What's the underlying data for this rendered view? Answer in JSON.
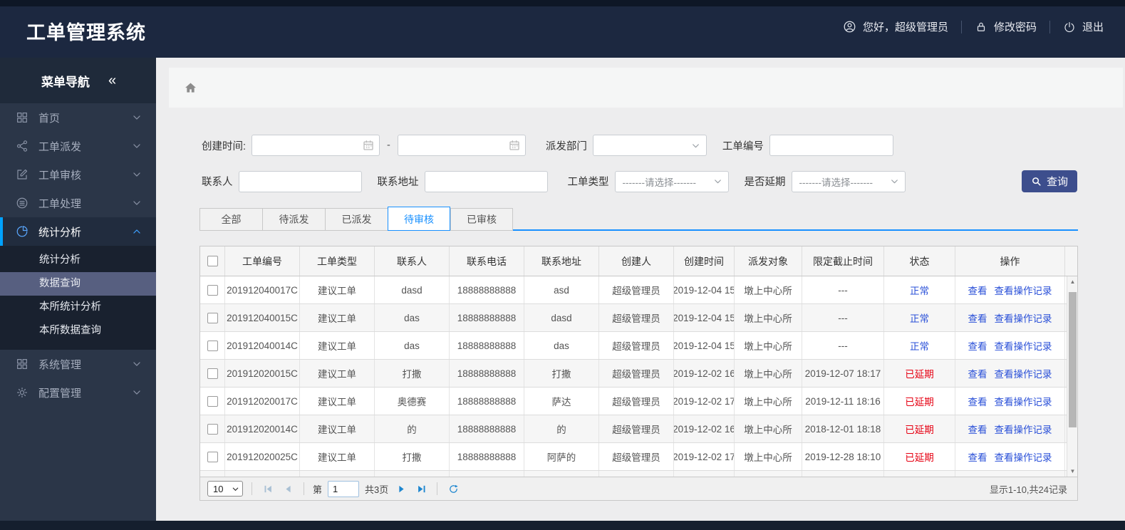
{
  "header": {
    "title": "工单管理系统",
    "greeting": "您好，超级管理员",
    "change_password": "修改密码",
    "logout": "退出"
  },
  "sidebar": {
    "title": "菜单导航",
    "collapse_icon": "«",
    "items": [
      {
        "key": "home",
        "label": "首页",
        "icon": "grid"
      },
      {
        "key": "order-dispatch",
        "label": "工单派发",
        "icon": "share"
      },
      {
        "key": "order-review",
        "label": "工单审核",
        "icon": "edit"
      },
      {
        "key": "order-process",
        "label": "工单处理",
        "icon": "stack"
      },
      {
        "key": "statistics",
        "label": "统计分析",
        "icon": "pie",
        "expanded": true,
        "children": [
          {
            "key": "statistics-analysis",
            "label": "统计分析",
            "active": false
          },
          {
            "key": "data-query",
            "label": "数据查询",
            "active": true
          },
          {
            "key": "bureau-statistics",
            "label": "本所统计分析",
            "active": false
          },
          {
            "key": "bureau-data-query",
            "label": "本所数据查询",
            "active": false
          }
        ]
      },
      {
        "key": "system-management",
        "label": "系统管理",
        "icon": "grid"
      },
      {
        "key": "config-management",
        "label": "配置管理",
        "icon": "gear"
      }
    ]
  },
  "filters": {
    "create_time_label": "创建时间:",
    "range_separator": "-",
    "dispatch_dept_label": "派发部门",
    "order_no_label": "工单编号",
    "contact_label": "联系人",
    "address_label": "联系地址",
    "order_type_label": "工单类型",
    "order_type_placeholder": "-------请选择-------",
    "delay_label": "是否延期",
    "delay_placeholder": "-------请选择-------",
    "search_button": "查询"
  },
  "tabs": [
    {
      "key": "all",
      "label": "全部",
      "active": false
    },
    {
      "key": "pending-dispatch",
      "label": "待派发",
      "active": false
    },
    {
      "key": "dispatched",
      "label": "已派发",
      "active": false
    },
    {
      "key": "pending-review",
      "label": "待审核",
      "active": true
    },
    {
      "key": "reviewed",
      "label": "已审核",
      "active": false
    }
  ],
  "table": {
    "headers": [
      "工单编号",
      "工单类型",
      "联系人",
      "联系电话",
      "联系地址",
      "创建人",
      "创建时间",
      "派发对象",
      "限定截止时间",
      "状态",
      "操作"
    ],
    "action_labels": [
      "查看",
      "查看操作记录"
    ],
    "rows": [
      {
        "order_no": "201912040017C",
        "type": "建议工单",
        "contact": "dasd",
        "phone": "18888888888",
        "address": "asd",
        "creator": "超级管理员",
        "created": "2019-12-04 15",
        "target": "墩上中心所",
        "deadline": "---",
        "status": "正常"
      },
      {
        "order_no": "201912040015C",
        "type": "建议工单",
        "contact": "das",
        "phone": "18888888888",
        "address": "dasd",
        "creator": "超级管理员",
        "created": "2019-12-04 15",
        "target": "墩上中心所",
        "deadline": "---",
        "status": "正常"
      },
      {
        "order_no": "201912040014C",
        "type": "建议工单",
        "contact": "das",
        "phone": "18888888888",
        "address": "das",
        "creator": "超级管理员",
        "created": "2019-12-04 15",
        "target": "墩上中心所",
        "deadline": "---",
        "status": "正常"
      },
      {
        "order_no": "201912020015C",
        "type": "建议工单",
        "contact": "打撒",
        "phone": "18888888888",
        "address": "打撒",
        "creator": "超级管理员",
        "created": "2019-12-02 16",
        "target": "墩上中心所",
        "deadline": "2019-12-07 18:17",
        "status": "已延期"
      },
      {
        "order_no": "201912020017C",
        "type": "建议工单",
        "contact": "奥德赛",
        "phone": "18888888888",
        "address": "萨达",
        "creator": "超级管理员",
        "created": "2019-12-02 17",
        "target": "墩上中心所",
        "deadline": "2019-12-11 18:16",
        "status": "已延期"
      },
      {
        "order_no": "201912020014C",
        "type": "建议工单",
        "contact": "的",
        "phone": "18888888888",
        "address": "的",
        "creator": "超级管理员",
        "created": "2019-12-02 16",
        "target": "墩上中心所",
        "deadline": "2018-12-01 18:18",
        "status": "已延期"
      },
      {
        "order_no": "201912020025C",
        "type": "建议工单",
        "contact": "打撒",
        "phone": "18888888888",
        "address": "阿萨的",
        "creator": "超级管理员",
        "created": "2019-12-02 17",
        "target": "墩上中心所",
        "deadline": "2019-12-28 18:10",
        "status": "已延期"
      },
      {
        "order_no": "",
        "type": "",
        "contact": "",
        "phone": "",
        "address": "",
        "creator": "",
        "created": "",
        "target": "",
        "deadline": "",
        "status": ""
      }
    ]
  },
  "pagination": {
    "page_size": "10",
    "page_prefix": "第",
    "current_page": "1",
    "total_pages": "共3页",
    "summary": "显示1-10,共24记录"
  },
  "colors": {
    "header_bg": "#1c2840",
    "sidebar_bg": "#2b3648",
    "accent_blue": "#1890ff",
    "link_blue": "#2a50d8",
    "status_normal": "#2a50d8",
    "status_delayed": "#e60012",
    "search_button_bg": "#3d4e8d",
    "active_submenu_bg": "#575f80"
  }
}
